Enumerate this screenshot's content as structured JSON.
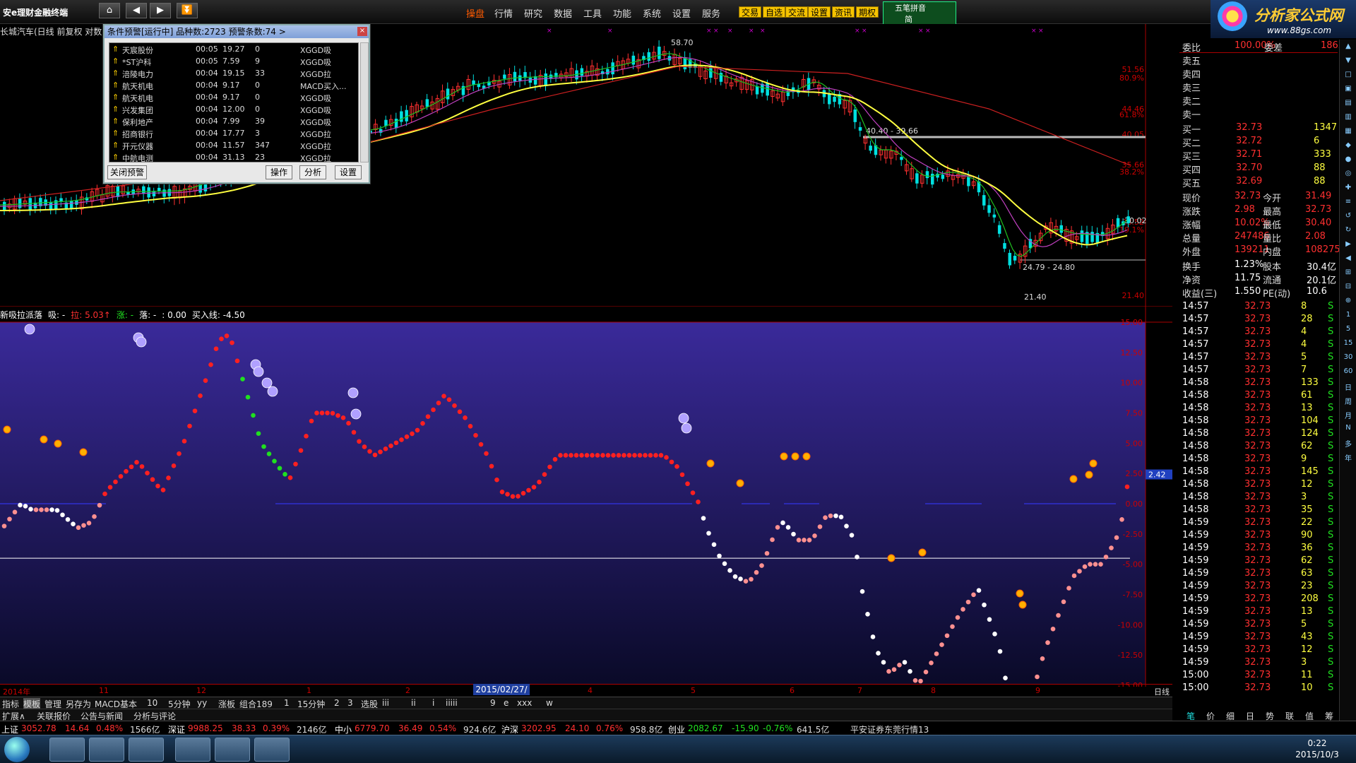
{
  "app": {
    "brand": "安e理财金融终端",
    "nav_icons": [
      "home-icon",
      "back-icon",
      "forward-icon",
      "down-icon"
    ]
  },
  "menu": [
    "操盘",
    "行情",
    "研究",
    "数据",
    "工具",
    "功能",
    "系统",
    "设置",
    "服务"
  ],
  "menu_active": "操盘",
  "quick_btns": [
    "交易",
    "自选",
    "交流",
    "设置",
    "资讯",
    "期权"
  ],
  "ime": {
    "line1": "五笔拼音",
    "line2": "简"
  },
  "logo": {
    "text": "分析家公式网",
    "url": "www.88gs.com"
  },
  "chart": {
    "title": "长城汽车(日线 前复权 对数)",
    "right_labels": [
      "51.56",
      "80.9%",
      "44.46",
      "61.8%",
      "40.05",
      "35.66",
      "38.2%",
      "28.52",
      "19.1%",
      "21.40"
    ],
    "annotations": [
      "58.70",
      "40.40 - 39.66",
      "30.02",
      "24.79 - 24.80",
      "21.40"
    ]
  },
  "indicator": {
    "title_parts": [
      "新吸拉派落",
      "吸: -",
      "拉: 5.03↑",
      "涨: -",
      "落: -",
      ": 0.00",
      "买入线: -4.50"
    ],
    "y_labels": [
      "15.00",
      "12.50",
      "10.00",
      "7.50",
      "5.00",
      "2.50",
      "0.00",
      "-2.50",
      "-5.00",
      "-7.50",
      "-10.00",
      "-12.50",
      "-15.00"
    ],
    "cur_value": "2.42"
  },
  "xaxis": {
    "labels": [
      "2014年",
      "11",
      "12",
      "1",
      "2",
      "3",
      "4",
      "5",
      "6",
      "7",
      "8",
      "9"
    ],
    "cursor_date": "2015/02/27/五",
    "period": "日线"
  },
  "alert": {
    "title": "条件预警[运行中] 品种数:2723 预警条数:74  >",
    "rows": [
      {
        "name": "天宸股份",
        "time": "00:05",
        "price": "19.27",
        "vol": "0",
        "sig": "XGGD吸"
      },
      {
        "name": "*ST沪科",
        "time": "00:05",
        "price": "7.59",
        "vol": "9",
        "sig": "XGGD吸"
      },
      {
        "name": "涪陵电力",
        "time": "00:04",
        "price": "19.15",
        "vol": "33",
        "sig": "XGGD拉"
      },
      {
        "name": "航天机电",
        "time": "00:04",
        "price": "9.17",
        "vol": "0",
        "sig": "MACD买入..."
      },
      {
        "name": "航天机电",
        "time": "00:04",
        "price": "9.17",
        "vol": "0",
        "sig": "XGGD吸"
      },
      {
        "name": "兴发集团",
        "time": "00:04",
        "price": "12.00",
        "vol": "0",
        "sig": "XGGD吸"
      },
      {
        "name": "保利地产",
        "time": "00:04",
        "price": "7.99",
        "vol": "39",
        "sig": "XGGD吸"
      },
      {
        "name": "招商银行",
        "time": "00:04",
        "price": "17.77",
        "vol": "3",
        "sig": "XGGD拉"
      },
      {
        "name": "开元仪器",
        "time": "00:04",
        "price": "11.57",
        "vol": "347",
        "sig": "XGGD拉"
      },
      {
        "name": "中航电测",
        "time": "00:04",
        "price": "31.13",
        "vol": "23",
        "sig": "XGGD拉"
      }
    ],
    "buttons": [
      "关闭预警",
      "操作",
      "分析",
      "设置"
    ]
  },
  "quote": {
    "weibi": {
      "label": "委比",
      "val": "100.00%",
      "label2": "委差",
      "val2": "1862"
    },
    "sells": [
      "卖五",
      "卖四",
      "卖三",
      "卖二",
      "卖一"
    ],
    "buys": [
      {
        "l": "买一",
        "p": "32.73",
        "v": "1347"
      },
      {
        "l": "买二",
        "p": "32.72",
        "v": "6"
      },
      {
        "l": "买三",
        "p": "32.71",
        "v": "333"
      },
      {
        "l": "买四",
        "p": "32.70",
        "v": "88"
      },
      {
        "l": "买五",
        "p": "32.69",
        "v": "88"
      }
    ],
    "stats": [
      {
        "a": "现价",
        "b": "32.73",
        "c": "今开",
        "d": "31.49"
      },
      {
        "a": "涨跌",
        "b": "2.98",
        "c": "最高",
        "d": "32.73"
      },
      {
        "a": "涨幅",
        "b": "10.02%",
        "c": "最低",
        "d": "30.40"
      },
      {
        "a": "总量",
        "b": "247486",
        "c": "量比",
        "d": "2.08"
      },
      {
        "a": "外盘",
        "b": "139211",
        "c": "内盘",
        "d": "108275"
      }
    ],
    "stats2": [
      {
        "a": "换手",
        "b": "1.23%",
        "c": "股本",
        "d": "30.4亿"
      },
      {
        "a": "净资",
        "b": "11.75",
        "c": "流通",
        "d": "20.1亿"
      },
      {
        "a": "收益(三)",
        "b": "1.550",
        "c": "PE(动)",
        "d": "10.6"
      }
    ],
    "ticks": [
      [
        "14:57",
        "32.73",
        "8",
        "S"
      ],
      [
        "14:57",
        "32.73",
        "28",
        "S"
      ],
      [
        "14:57",
        "32.73",
        "4",
        "S"
      ],
      [
        "14:57",
        "32.73",
        "4",
        "S"
      ],
      [
        "14:57",
        "32.73",
        "5",
        "S"
      ],
      [
        "14:57",
        "32.73",
        "7",
        "S"
      ],
      [
        "14:58",
        "32.73",
        "133",
        "S"
      ],
      [
        "14:58",
        "32.73",
        "61",
        "S"
      ],
      [
        "14:58",
        "32.73",
        "13",
        "S"
      ],
      [
        "14:58",
        "32.73",
        "104",
        "S"
      ],
      [
        "14:58",
        "32.73",
        "124",
        "S"
      ],
      [
        "14:58",
        "32.73",
        "62",
        "S"
      ],
      [
        "14:58",
        "32.73",
        "9",
        "S"
      ],
      [
        "14:58",
        "32.73",
        "145",
        "S"
      ],
      [
        "14:58",
        "32.73",
        "12",
        "S"
      ],
      [
        "14:58",
        "32.73",
        "3",
        "S"
      ],
      [
        "14:58",
        "32.73",
        "35",
        "S"
      ],
      [
        "14:59",
        "32.73",
        "22",
        "S"
      ],
      [
        "14:59",
        "32.73",
        "90",
        "S"
      ],
      [
        "14:59",
        "32.73",
        "36",
        "S"
      ],
      [
        "14:59",
        "32.73",
        "62",
        "S"
      ],
      [
        "14:59",
        "32.73",
        "63",
        "S"
      ],
      [
        "14:59",
        "32.73",
        "23",
        "S"
      ],
      [
        "14:59",
        "32.73",
        "208",
        "S"
      ],
      [
        "14:59",
        "32.73",
        "13",
        "S"
      ],
      [
        "14:59",
        "32.73",
        "5",
        "S"
      ],
      [
        "14:59",
        "32.73",
        "43",
        "S"
      ],
      [
        "14:59",
        "32.73",
        "12",
        "S"
      ],
      [
        "14:59",
        "32.73",
        "3",
        "S"
      ],
      [
        "15:00",
        "32.73",
        "11",
        "S"
      ],
      [
        "15:00",
        "32.73",
        "10",
        "S"
      ]
    ]
  },
  "tabs1": [
    "指标",
    "模板",
    "管理",
    "另存为",
    "MACD基本",
    "10",
    "5分钟",
    "yy",
    "涨板",
    "组合189",
    "1",
    "15分钟",
    "2",
    "3",
    "选股",
    "iii",
    "ii",
    "i",
    "iiiii",
    "9",
    "e",
    "xxx",
    "w"
  ],
  "tabs2": [
    "扩展∧",
    "关联报价",
    "公告与新闻",
    "分析与评论"
  ],
  "right_bottom_tabs": [
    "笔",
    "价",
    "细",
    "日",
    "势",
    "联",
    "值",
    "筹"
  ],
  "ticker": [
    {
      "name": "上证",
      "val": "3052.78",
      "chg": "14.64",
      "pct": "0.48%",
      "amt": "1566亿"
    },
    {
      "name": "深证",
      "val": "9988.25",
      "chg": "38.33",
      "pct": "0.39%",
      "amt": "2146亿"
    },
    {
      "name": "中小",
      "val": "6779.70",
      "chg": "36.49",
      "pct": "0.54%",
      "amt": "924.6亿"
    },
    {
      "name": "沪深",
      "val": "3202.95",
      "chg": "24.10",
      "pct": "0.76%",
      "amt": "958.8亿"
    },
    {
      "name": "创业",
      "val": "2082.67",
      "chg": "-15.90",
      "pct": "-0.76%",
      "amt": "641.5亿"
    }
  ],
  "broker": "平安证券东莞行情13",
  "clock": {
    "time": "0:22",
    "date": "2015/10/3"
  },
  "colors": {
    "up": "#ff3030",
    "down": "#00e0e0",
    "ma_yellow": "#ffff40",
    "ma_red": "#cc2020",
    "ma_purple": "#c040c0",
    "ma_green": "#20c020",
    "ind_bg_top": "#3a2a9a",
    "ind_bg_bot": "#0a0a28"
  }
}
